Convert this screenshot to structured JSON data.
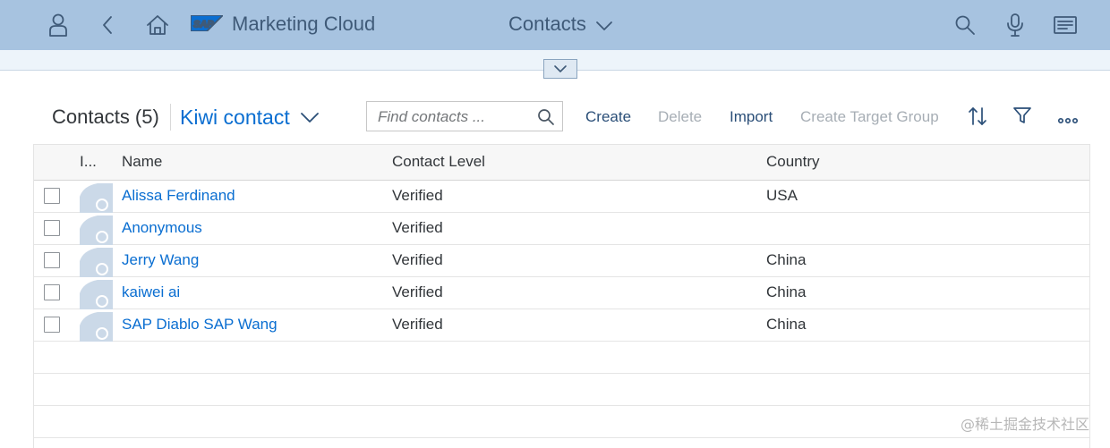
{
  "shell": {
    "logo_text": "SAP",
    "app_title": "Marketing Cloud",
    "center_title": "Contacts"
  },
  "toolbar": {
    "title": "Contacts (5)",
    "variant": "Kiwi contact",
    "search_placeholder": "Find contacts ...",
    "buttons": {
      "create": "Create",
      "delete": "Delete",
      "import": "Import",
      "create_target_group": "Create Target Group"
    }
  },
  "table": {
    "columns": {
      "image": "I...",
      "name": "Name",
      "contact_level": "Contact Level",
      "country": "Country"
    },
    "rows": [
      {
        "name": "Alissa Ferdinand",
        "level": "Verified",
        "country": "USA"
      },
      {
        "name": "Anonymous",
        "level": "Verified",
        "country": ""
      },
      {
        "name": "Jerry Wang",
        "level": "Verified",
        "country": "China"
      },
      {
        "name": "kaiwei ai",
        "level": "Verified",
        "country": "China"
      },
      {
        "name": "SAP Diablo SAP Wang",
        "level": "Verified",
        "country": "China"
      }
    ]
  },
  "watermark": "@稀土掘金技术社区",
  "colors": {
    "shell_bg": "#a7c3e0",
    "link": "#0a6ed1",
    "toolbar_button": "#2b4f78",
    "disabled": "#a7aeb5"
  },
  "icons": [
    "user-icon",
    "back-icon",
    "home-icon",
    "sap-logo",
    "chevron-down-icon",
    "search-icon",
    "microphone-icon",
    "menu-icon",
    "collapse-chevron-icon",
    "sort-icon",
    "filter-icon",
    "more-icon",
    "checkbox",
    "avatar-placeholder"
  ]
}
